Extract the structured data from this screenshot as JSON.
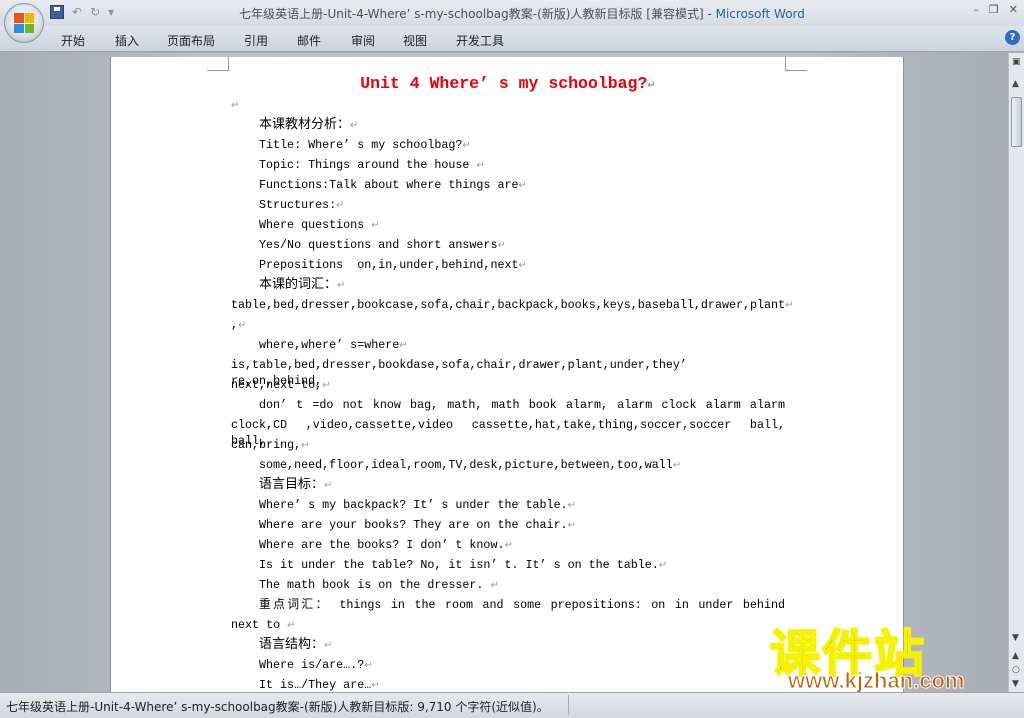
{
  "window": {
    "title_doc": "七年级英语上册-Unit-4-Where’ s-my-schoolbag教案-(新版)人教新目标版 [兼容模式]",
    "title_sep": " - ",
    "title_app": "Microsoft Word",
    "minimize": "–",
    "restore": "❐",
    "close": "✕"
  },
  "qat": {
    "undo": "↶",
    "redo": "↻",
    "customize": "▾"
  },
  "ribbon": {
    "tabs": [
      "开始",
      "插入",
      "页面布局",
      "引用",
      "邮件",
      "审阅",
      "视图",
      "开发工具"
    ],
    "help": "?"
  },
  "document": {
    "title": "Unit 4 Where’ s my schoolbag?",
    "lines": [
      {
        "text": "",
        "style": "cont"
      },
      {
        "text": "本课教材分析：",
        "style": "ind cn"
      },
      {
        "text": "Title: Where’ s my schoolbag?",
        "style": "ind"
      },
      {
        "text": "Topic: Things around the house ",
        "style": "ind"
      },
      {
        "text": "Functions:Talk about where things are",
        "style": "ind"
      },
      {
        "text": "Structures:",
        "style": "ind"
      },
      {
        "text": "Where questions ",
        "style": "ind"
      },
      {
        "text": "Yes/No questions and short answers",
        "style": "ind"
      },
      {
        "text": "Prepositions  on,in,under,behind,next",
        "style": "ind"
      },
      {
        "text": "本课的词汇：",
        "style": "ind cn"
      },
      {
        "text": "table,bed,dresser,bookcase,sofa,chair,backpack,books,keys,baseball,drawer,plant",
        "style": "cont"
      },
      {
        "text": ",",
        "style": "cont"
      },
      {
        "text": "where,where’ s=where",
        "style": "ind"
      },
      {
        "text": "is,table,bed,dresser,bookdase,sofa,chair,drawer,plant,under,they’ re,on,behind,",
        "style": "cont just"
      },
      {
        "text": "next,next to,",
        "style": "cont"
      },
      {
        "text": "don’ t =do not  know  bag, math, math book alarm, alarm clock  alarm  alarm",
        "style": "ind just"
      },
      {
        "text": "clock,CD ,video,cassette,video cassette,hat,take,thing,soccer,soccer ball, ball,",
        "style": "cont just"
      },
      {
        "text": "can,bring,",
        "style": "cont"
      },
      {
        "text": "some,need,floor,ideal,room,TV,desk,picture,between,too,wall",
        "style": "ind"
      },
      {
        "text": "语言目标：",
        "style": "ind cn"
      },
      {
        "text": "Where’ s my backpack? It’ s under the table.",
        "style": "ind"
      },
      {
        "text": "Where are your books? They are on the chair.",
        "style": "ind"
      },
      {
        "text": "Where are the books? I don’ t know.",
        "style": "ind"
      },
      {
        "text": "Is it under the table? No, it isn’ t. It’ s on the table.",
        "style": "ind"
      },
      {
        "text": "The math book is on the dresser. ",
        "style": "ind"
      },
      {
        "text": "重点词汇： things in the room and some prepositions:  on  in  under  behind",
        "style": "ind just"
      },
      {
        "text": "next to ",
        "style": "cont"
      },
      {
        "text": "语言结构：",
        "style": "ind cn"
      },
      {
        "text": "Where is/are….?",
        "style": "ind"
      },
      {
        "text": "It is…/They are…",
        "style": "ind"
      }
    ]
  },
  "statusbar": {
    "text": "七年级英语上册-Unit-4-Where’ s-my-schoolbag教案-(新版)人教新目标版: 9,710 个字符(近似值)。"
  },
  "watermark": {
    "cn": "课件站",
    "url": "www.kjzhan.com"
  }
}
